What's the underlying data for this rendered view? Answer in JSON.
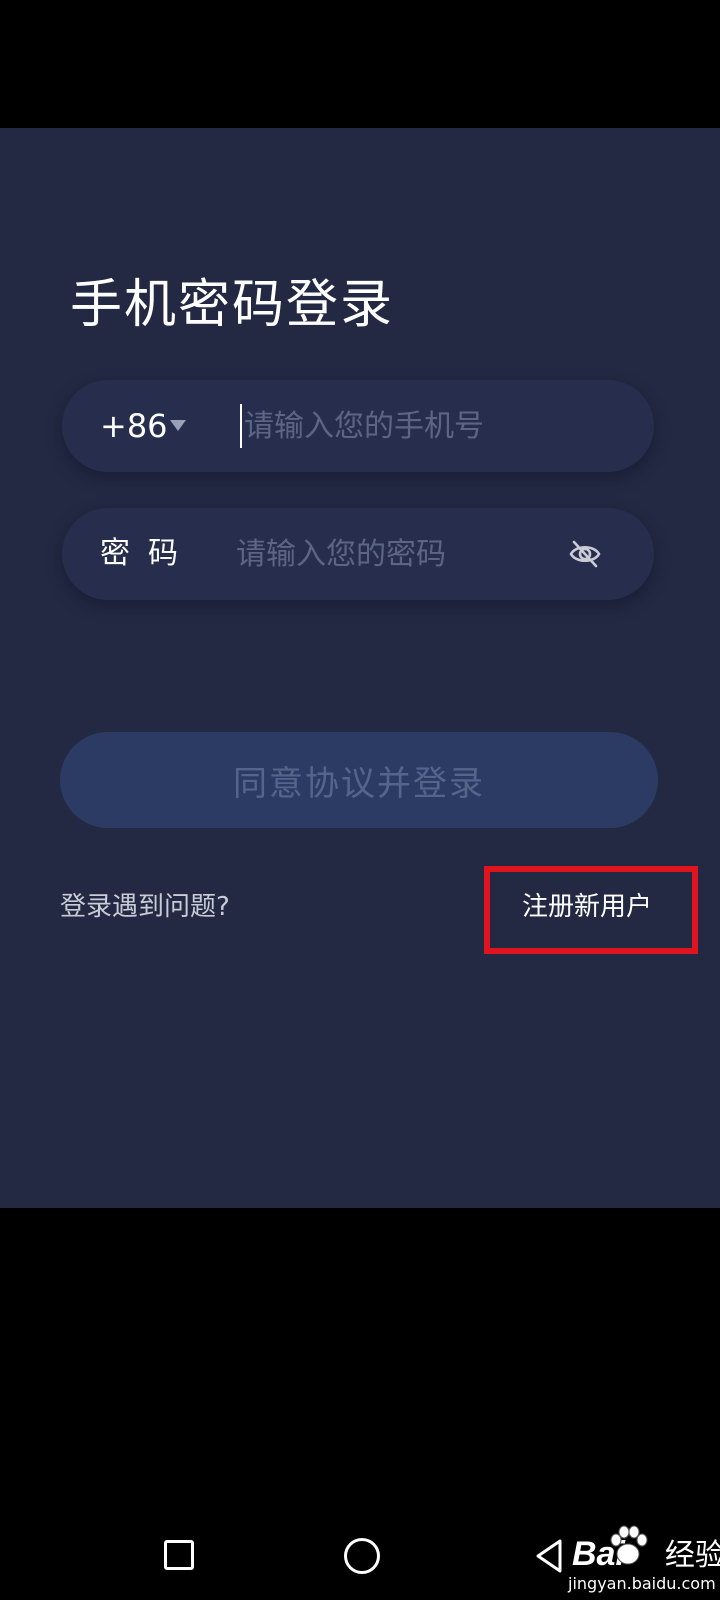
{
  "login": {
    "title": "手机密码登录",
    "phone": {
      "country_code": "+86",
      "placeholder": "请输入您的手机号",
      "value": ""
    },
    "password": {
      "label": "密码",
      "placeholder": "请输入您的密码",
      "value": "",
      "visibility_icon": "eye-off-icon"
    },
    "login_button": "同意协议并登录",
    "help_link": "登录遇到问题?",
    "register_link": "注册新用户"
  },
  "annotation": {
    "highlight_color": "#e0141f",
    "highlighted_target": "注册新用户"
  },
  "nav_bar": {
    "recents_icon": "square-icon",
    "home_icon": "circle-icon",
    "back_icon": "triangle-back-icon"
  },
  "watermark": {
    "brand": "Bai",
    "brand_suffix": "经验",
    "site": "jingyan.baidu.com"
  },
  "colors": {
    "background": "#232943",
    "field_background": "#272e4d",
    "button_background": "#2b3b64",
    "button_text": "#56648a",
    "placeholder": "#5d6585"
  }
}
